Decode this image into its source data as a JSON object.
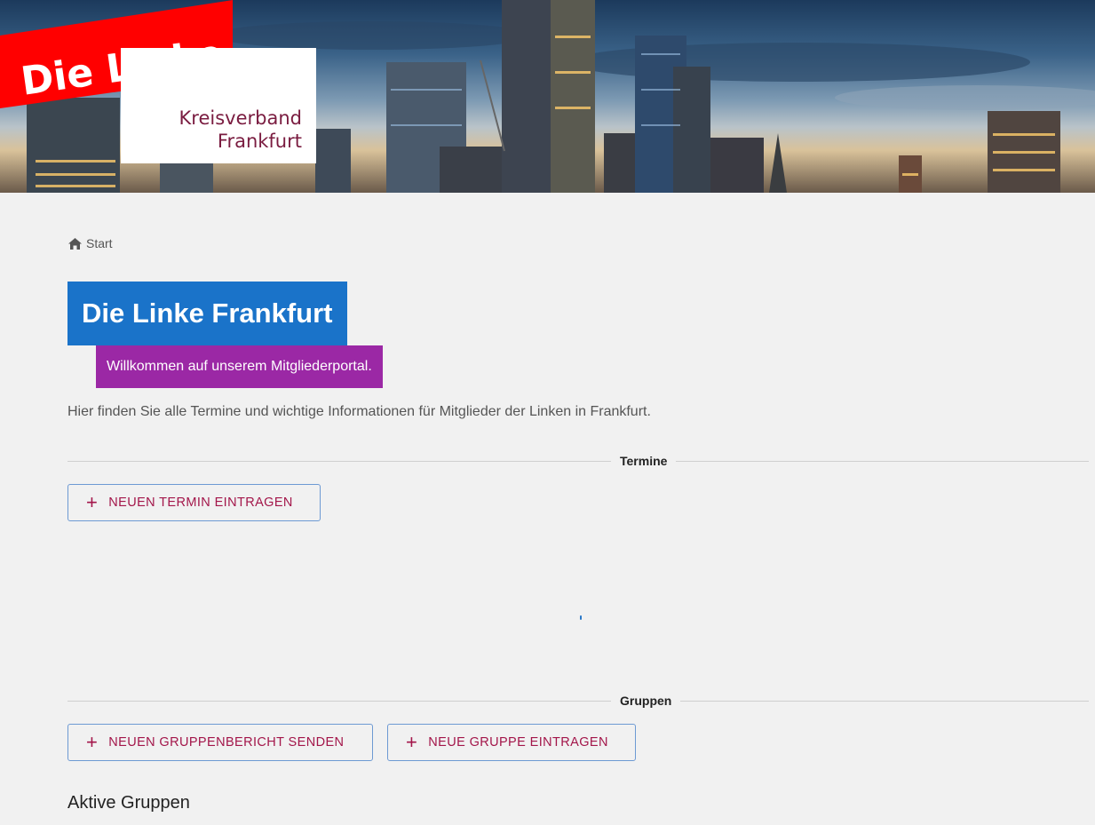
{
  "header": {
    "logo_text": "Die Linke",
    "logo_sub_line1": "Kreisverband",
    "logo_sub_line2": "Frankfurt"
  },
  "breadcrumb": {
    "home_label": "Start"
  },
  "main": {
    "title": "Die Linke Frankfurt",
    "subtitle": "Willkommen auf unserem Mitgliederportal.",
    "intro": "Hier finden Sie alle Termine und wichtige Informationen für Mitglieder der Linken in Frankfurt."
  },
  "termine": {
    "heading": "Termine",
    "add_button": "NEUEN TERMIN EINTRAGEN"
  },
  "gruppen": {
    "heading": "Gruppen",
    "report_button": "NEUEN GRUPPENBERICHT SENDEN",
    "add_button": "NEUE GRUPPE EINTRAGEN",
    "active_heading": "Aktive Gruppen"
  },
  "colors": {
    "title_bg": "#1a73c9",
    "subtitle_bg": "#9b28a5",
    "button_text": "#a3164a",
    "logo_red": "#ff0000",
    "logo_sub": "#7a1c40"
  },
  "icons": {
    "home": "home-icon",
    "plus": "plus-icon"
  }
}
